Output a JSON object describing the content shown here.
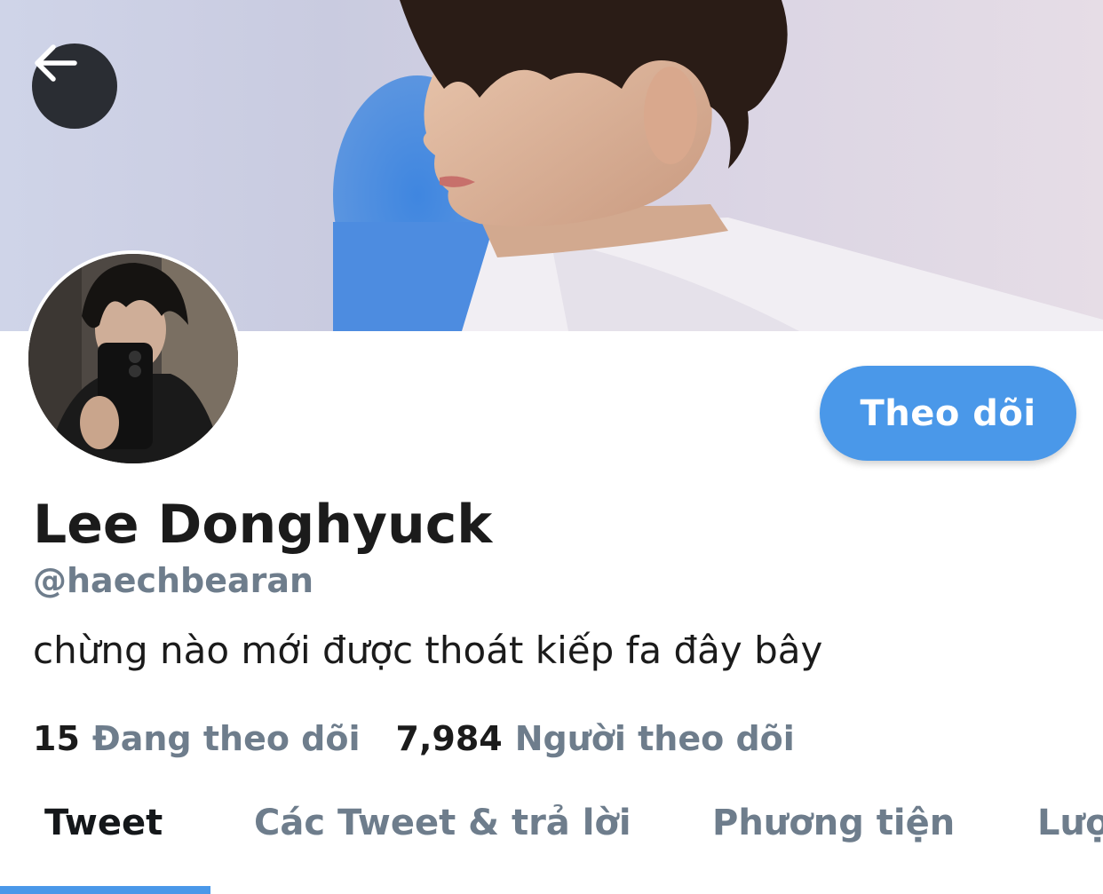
{
  "header": {
    "back_icon": "arrow-left-icon"
  },
  "profile": {
    "display_name": "Lee Donghyuck",
    "handle": "@haechbearan",
    "bio": "chừng nào mới được thoát kiếp fa đây bây",
    "follow_label": "Theo dõi",
    "following_count": "15",
    "following_label": "Đang theo dõi",
    "followers_count": "7,984",
    "followers_label": "Người theo dõi"
  },
  "tabs": [
    {
      "label": "Tweet",
      "active": true
    },
    {
      "label": "Các Tweet & trả lời",
      "active": false
    },
    {
      "label": "Phương tiện",
      "active": false
    },
    {
      "label": "Lượt thích",
      "active": false
    }
  ],
  "colors": {
    "accent": "#4a98e9",
    "secondary_text": "#6e7d8c",
    "primary_text": "#1b1b1b"
  }
}
